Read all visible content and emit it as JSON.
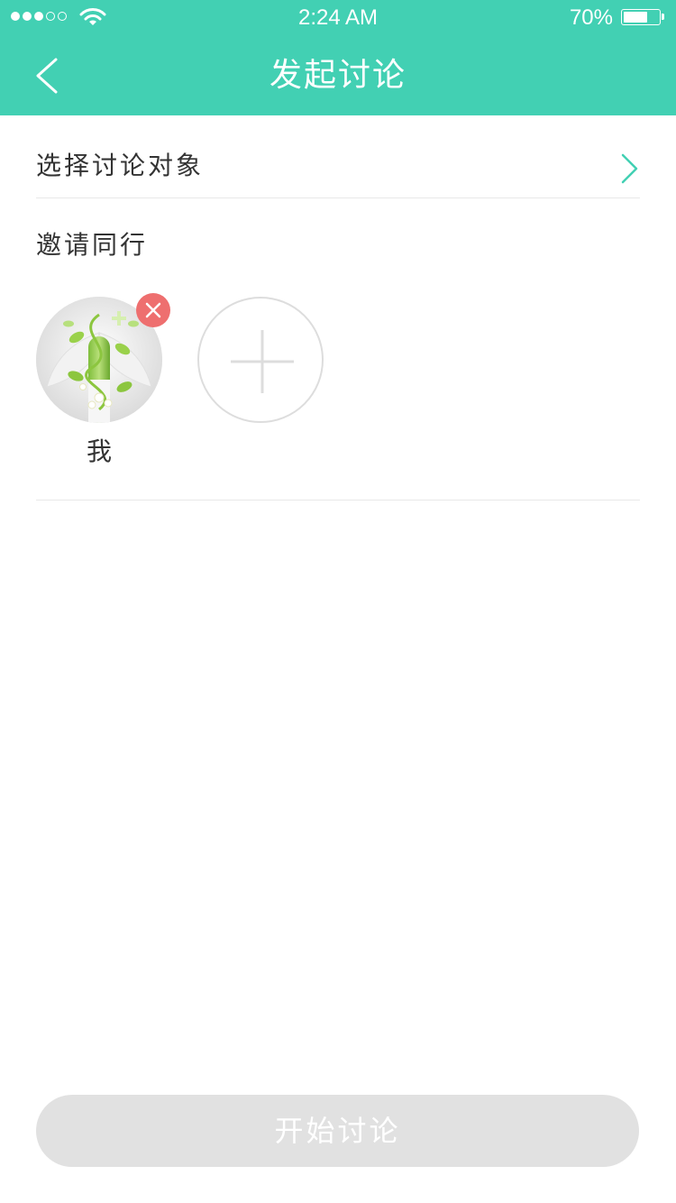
{
  "status_bar": {
    "time": "2:24 AM",
    "battery_percent": "70%",
    "battery_level": 0.7,
    "signal_bars_filled": 3,
    "signal_bars_total": 5
  },
  "nav": {
    "title": "发起讨论",
    "back_icon": "chevron-left-icon"
  },
  "select_target": {
    "label": "选择讨论对象",
    "arrow_icon": "chevron-right-icon"
  },
  "invite": {
    "label": "邀请同行",
    "members": [
      {
        "name": "我",
        "avatar_icon": "avatar-image",
        "remove_icon": "close-icon"
      }
    ],
    "add_icon": "plus-icon"
  },
  "actions": {
    "start_label": "开始讨论"
  },
  "colors": {
    "accent": "#42d0b3",
    "remove_badge": "#ee6f6f",
    "disabled_button": "#e1e1e1",
    "divider": "#e8e8e8"
  }
}
